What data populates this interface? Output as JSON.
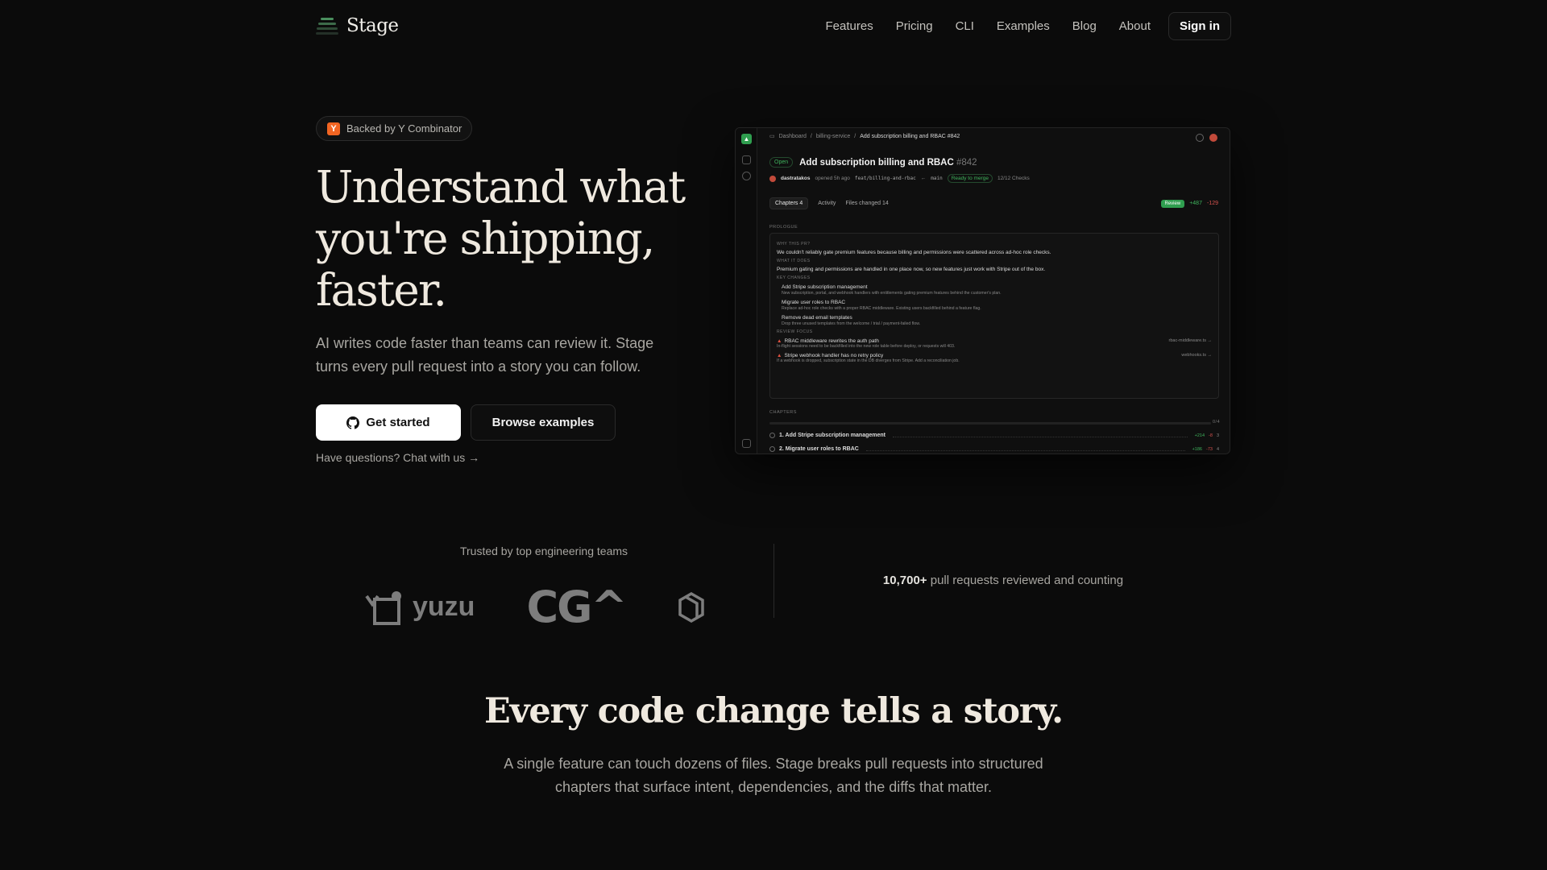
{
  "nav": {
    "brand": "Stage",
    "links": [
      "Features",
      "Pricing",
      "CLI",
      "Examples",
      "Blog",
      "About"
    ],
    "signin": "Sign in"
  },
  "hero": {
    "badge": "Backed by Y Combinator",
    "badge_icon_letter": "Y",
    "title": "Understand what you're shipping, faster.",
    "subtitle": "AI writes code faster than teams can review it. Stage turns every pull request into a story you can follow.",
    "primary_cta": "Get started",
    "secondary_cta": "Browse examples",
    "chat_link": "Have questions? Chat with us →"
  },
  "preview": {
    "crumbs": [
      "Dashboard",
      "billing-service",
      "Add subscription billing and RBAC #842"
    ],
    "status": "Open",
    "pr_title": "Add subscription billing and RBAC",
    "pr_number": "#842",
    "author": "dastratakos",
    "opened": "opened 5h ago",
    "branch_from": "feat/billing-and-rbac",
    "branch_to": "main",
    "ready": "Ready to merge",
    "checks": "12/12 Checks",
    "tabs": [
      {
        "label": "Chapters",
        "count": "4"
      },
      {
        "label": "Activity",
        "count": ""
      },
      {
        "label": "Files changed",
        "count": "14"
      }
    ],
    "review_label": "Review",
    "additions": "+487",
    "deletions": "-129",
    "prologue_label": "PROLOGUE",
    "why_label": "WHY THIS PR?",
    "why_text": "We couldn't reliably gate premium features because billing and permissions were scattered across ad-hoc role checks.",
    "what_label": "WHAT IT DOES",
    "what_text": "Premium gating and permissions are handled in one place now, so new features just work with Stripe out of the box.",
    "key_label": "KEY CHANGES",
    "key_changes": [
      {
        "title": "Add Stripe subscription management",
        "desc": "New subscription, portal, and webhook handlers with entitlements gating premium features behind the customer's plan."
      },
      {
        "title": "Migrate user roles to RBAC",
        "desc": "Replace ad-hoc role checks with a proper RBAC middleware. Existing users backfilled behind a feature flag."
      },
      {
        "title": "Remove dead email templates",
        "desc": "Drop three unused templates from the welcome / trial / payment-failed flow."
      }
    ],
    "focus_label": "REVIEW FOCUS",
    "focus": [
      {
        "title": "RBAC middleware rewrites the auth path",
        "desc": "In-flight sessions need to be backfilled into the new role table before deploy, or requests will 403.",
        "file": "rbac-middleware.ts →"
      },
      {
        "title": "Stripe webhook handler has no retry policy",
        "desc": "If a webhook is dropped, subscription state in the DB diverges from Stripe. Add a reconciliation job.",
        "file": "webhooks.ts →"
      }
    ],
    "chapters_label": "CHAPTERS",
    "chapters_progress": "0/4",
    "chapters": [
      {
        "title": "1. Add Stripe subscription management",
        "add": "+214",
        "del": "-8",
        "files": "3"
      },
      {
        "title": "2. Migrate user roles to RBAC",
        "add": "+186",
        "del": "-73",
        "files": "4"
      }
    ]
  },
  "trusted": {
    "label": "Trusted by top engineering teams",
    "logos": [
      "yuzu",
      "CG^"
    ],
    "count_strong": "10,700+",
    "count_rest": " pull requests reviewed and counting"
  },
  "story": {
    "title": "Every code change tells a story.",
    "subtitle": "A single feature can touch dozens of files. Stage breaks pull requests into structured chapters that surface intent, dependencies, and the diffs that matter."
  },
  "colors": {
    "background": "#0b0b0b",
    "accent_green": "#2f9e4f",
    "yc_orange": "#f26522",
    "warn_red": "#e0513f"
  }
}
